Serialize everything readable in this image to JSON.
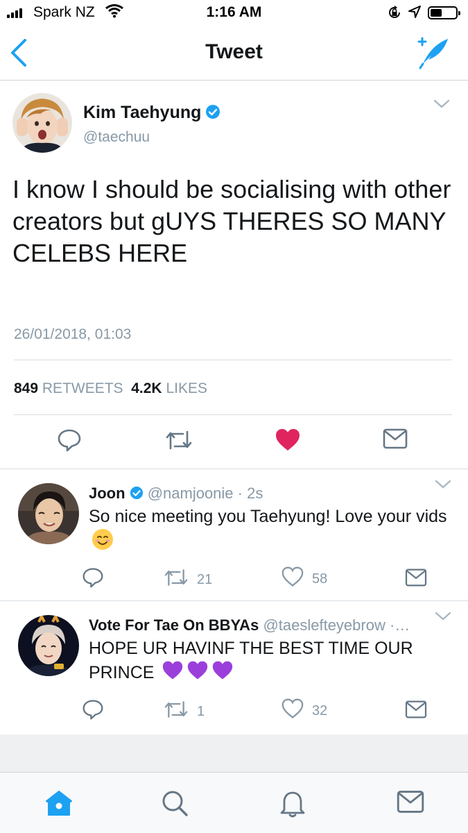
{
  "status_bar": {
    "carrier": "Spark NZ",
    "time": "1:16 AM",
    "battery_level": 0.4
  },
  "nav": {
    "title": "Tweet",
    "back_icon": "chevron-left-icon",
    "compose_icon": "compose-feather-icon"
  },
  "tweet": {
    "author_name": "Kim Taehyung",
    "author_handle": "@taechuu",
    "verified": true,
    "text": "I know I should be socialising with other creators but gUYS THERES SO MANY CELEBS HERE",
    "timestamp": "26/01/2018, 01:03",
    "retweet_count": "849",
    "retweet_label": "RETWEETS",
    "like_count": "4.2K",
    "like_label": "LIKES",
    "liked": true
  },
  "replies": [
    {
      "name": "Joon",
      "verified": true,
      "handle": "@namjoonie",
      "time": "· 2s",
      "text": "So nice meeting you Taehyung! Love your vids",
      "retweets": "21",
      "likes": "58"
    },
    {
      "name": "Vote For Tae On BBYAs",
      "handle": "@taeslefteyebrow",
      "time": "·…",
      "text": "HOPE UR HAVINF THE BEST TIME OUR PRINCE",
      "retweets": "1",
      "likes": "32"
    }
  ],
  "colors": {
    "accent": "#1da1f2",
    "like_red": "#e0245e",
    "muted": "#8899a6",
    "text": "#14171a",
    "purple_heart": "#9b3fdb"
  }
}
